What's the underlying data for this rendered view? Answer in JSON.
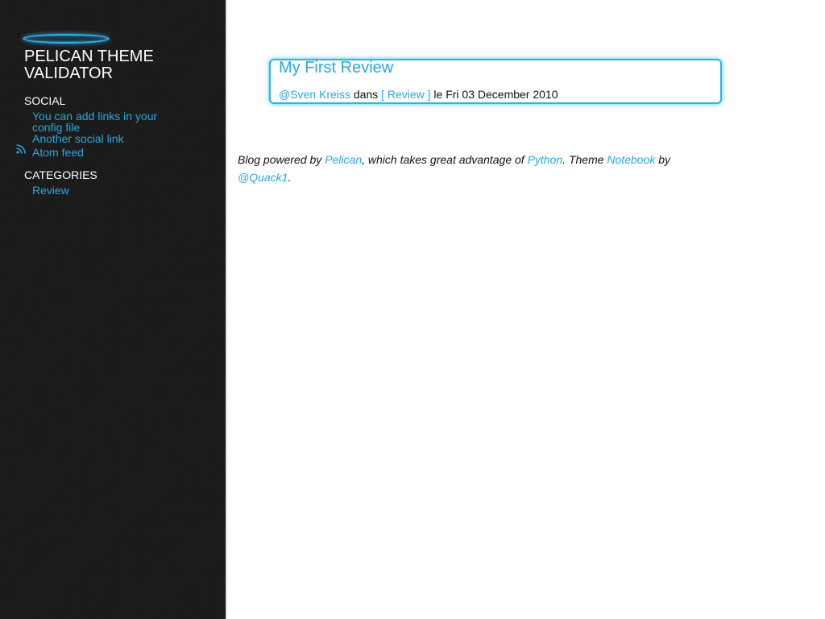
{
  "sidebar": {
    "site_title": "PELICAN THEME VALIDATOR",
    "social": {
      "heading": "SOCIAL",
      "links": [
        "You can add links in your config file",
        "Another social link"
      ],
      "feed_label": "Atom feed",
      "feed_icon": "rss-icon"
    },
    "categories": {
      "heading": "CATEGORIES",
      "items": [
        "Review"
      ]
    }
  },
  "article": {
    "title": "My First Review",
    "author": "@Sven Kreiss",
    "in_word": "dans",
    "category": "[ Review ]",
    "date_prefix": "le",
    "date": "Fri 03 December 2010"
  },
  "footer": {
    "text_1": "Blog powered by ",
    "pelican": "Pelican",
    "text_2": ", which takes great advantage of ",
    "python": "Python",
    "text_3": ". Theme ",
    "notebook": "Notebook",
    "text_4": " by",
    "quack": "@Quack1",
    "text_5": "."
  },
  "colors": {
    "link": "#2aa8dc",
    "sidebar_bg": "#1c1c1c",
    "accent_glow": "#29b6e6"
  }
}
